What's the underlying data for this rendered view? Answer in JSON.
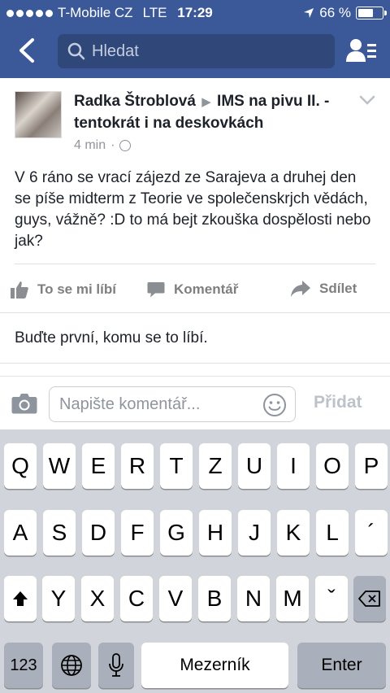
{
  "status_bar": {
    "carrier": "T-Mobile CZ",
    "network": "LTE",
    "time": "17:29",
    "battery": "66 %",
    "battery_level": 0.66
  },
  "nav": {
    "search_placeholder": "Hledat"
  },
  "post": {
    "author": "Radka Štroblová",
    "group": "IMS na pivu II. - tentokrát i na deskovkách",
    "time": "4 min",
    "separator": "·",
    "text": "V 6 ráno se vrací zájezd ze Sarajeva a druhej den se píše midterm z Teorie ve společenskrjch vědách, guys, vážně? :D to má bejt zkouška dospělosti nebo jak?",
    "actions": {
      "like": "To se mi líbí",
      "comment": "Komentář",
      "share": "Sdílet"
    },
    "likes_summary": "Buďte první, komu se to líbí."
  },
  "comment_bar": {
    "placeholder": "Napište komentář...",
    "post_label": "Přidat"
  },
  "keyboard": {
    "row1": [
      "Q",
      "W",
      "E",
      "R",
      "T",
      "Z",
      "U",
      "I",
      "O",
      "P"
    ],
    "row2": [
      "A",
      "S",
      "D",
      "F",
      "G",
      "H",
      "J",
      "K",
      "L",
      "´"
    ],
    "row3": [
      "Y",
      "X",
      "C",
      "V",
      "B",
      "N",
      "M",
      "ˇ"
    ],
    "numbers_label": "123",
    "space_label": "Mezerník",
    "enter_label": "Enter"
  },
  "colors": {
    "facebook_blue": "#3b5998",
    "search_bg": "#2f4779",
    "keyboard_bg": "#d1d5db",
    "muted_text": "#90949c"
  }
}
